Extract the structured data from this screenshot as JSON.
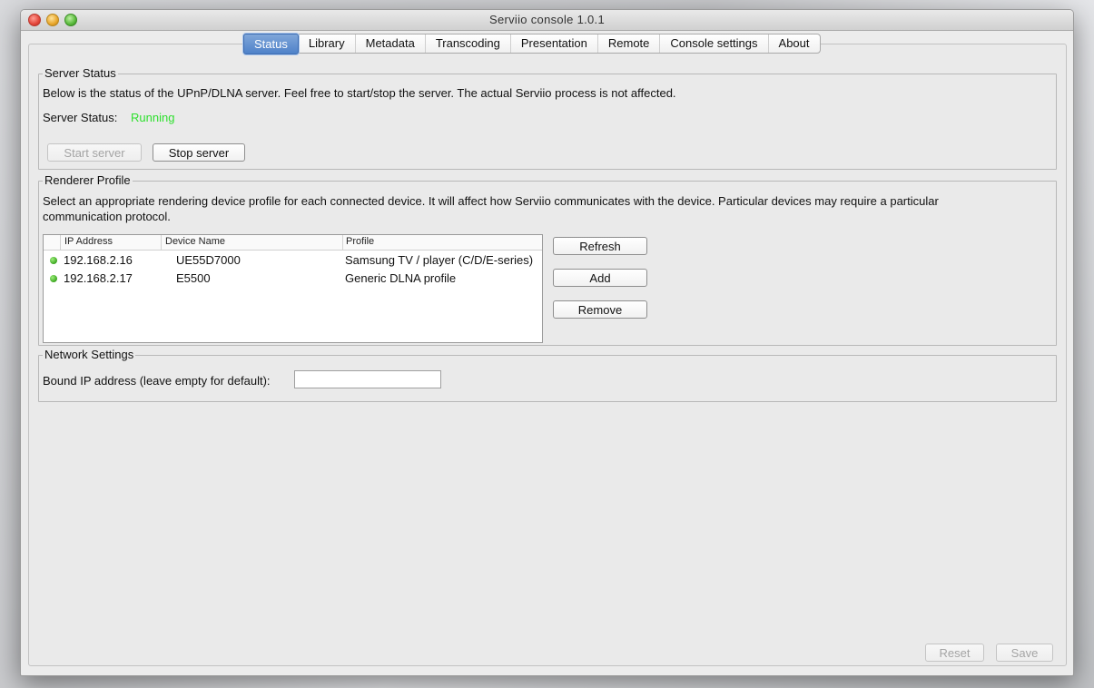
{
  "window": {
    "title": "Serviio console 1.0.1"
  },
  "tabs": [
    {
      "label": "Status",
      "active": true
    },
    {
      "label": "Library"
    },
    {
      "label": "Metadata"
    },
    {
      "label": "Transcoding"
    },
    {
      "label": "Presentation"
    },
    {
      "label": "Remote"
    },
    {
      "label": "Console settings"
    },
    {
      "label": "About"
    }
  ],
  "server_status": {
    "legend": "Server Status",
    "description": "Below is the status of the UPnP/DLNA server. Feel free to start/stop the server. The actual Serviio process is not affected.",
    "status_label": "Server Status:",
    "status_value": "Running",
    "status_color": "#2ee02e",
    "start_button": "Start server",
    "stop_button": "Stop server"
  },
  "renderer_profile": {
    "legend": "Renderer Profile",
    "description_line1": "Select an appropriate rendering device profile for each connected device. It will affect how Serviio communicates with the device. Particular devices may require a particular",
    "description_line2": "communication protocol.",
    "columns": [
      "IP Address",
      "Device Name",
      "Profile"
    ],
    "rows": [
      {
        "ip": "192.168.2.16",
        "device": "UE55D7000",
        "profile": "Samsung TV / player (C/D/E-series)"
      },
      {
        "ip": "192.168.2.17",
        "device": "E5500",
        "profile": "Generic DLNA profile"
      }
    ],
    "refresh_button": "Refresh",
    "add_button": "Add",
    "remove_button": "Remove"
  },
  "network_settings": {
    "legend": "Network Settings",
    "bound_ip_label": "Bound IP address (leave empty for default):",
    "bound_ip_value": ""
  },
  "footer": {
    "reset_button": "Reset",
    "save_button": "Save"
  }
}
